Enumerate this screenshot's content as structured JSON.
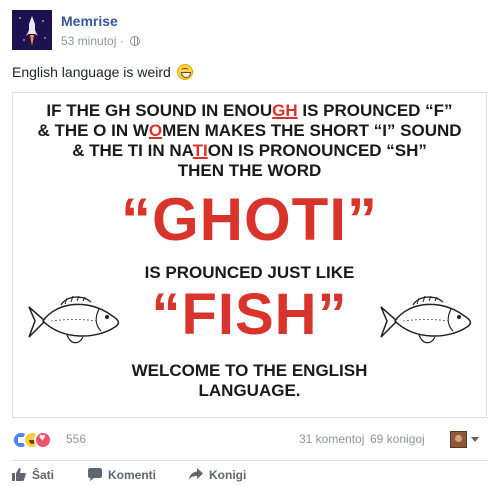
{
  "post": {
    "page_name": "Memrise",
    "time": "53 minutoj",
    "separator": "·",
    "text": "English language is weird"
  },
  "image": {
    "line1_a": "IF THE GH SOUND IN ENOU",
    "line1_hl": "GH",
    "line1_b": " IS PROUNCED “F”",
    "line2_a": "& THE O IN W",
    "line2_hl": "O",
    "line2_b": "MEN MAKES THE SHORT “I” SOUND",
    "line3_a": "& THE TI IN NA",
    "line3_hl": "TI",
    "line3_b": "ON IS PRONOUNCED “SH”",
    "line4": "THEN THE WORD",
    "ghoti": "“GHOTI”",
    "line5": "IS PROUNCED JUST LIKE",
    "fish": "“FISH”",
    "line6": "WELCOME TO THE ENGLISH",
    "line7": "LANGUAGE."
  },
  "stats": {
    "reaction_count": "556",
    "comments": "31 komentoj",
    "shares": "69 konigoj"
  },
  "actions": {
    "like": "Ŝati",
    "comment": "Komenti",
    "share": "Konigi"
  },
  "colors": {
    "link": "#365899",
    "accent_red": "#d9342b",
    "muted": "#90949c"
  }
}
